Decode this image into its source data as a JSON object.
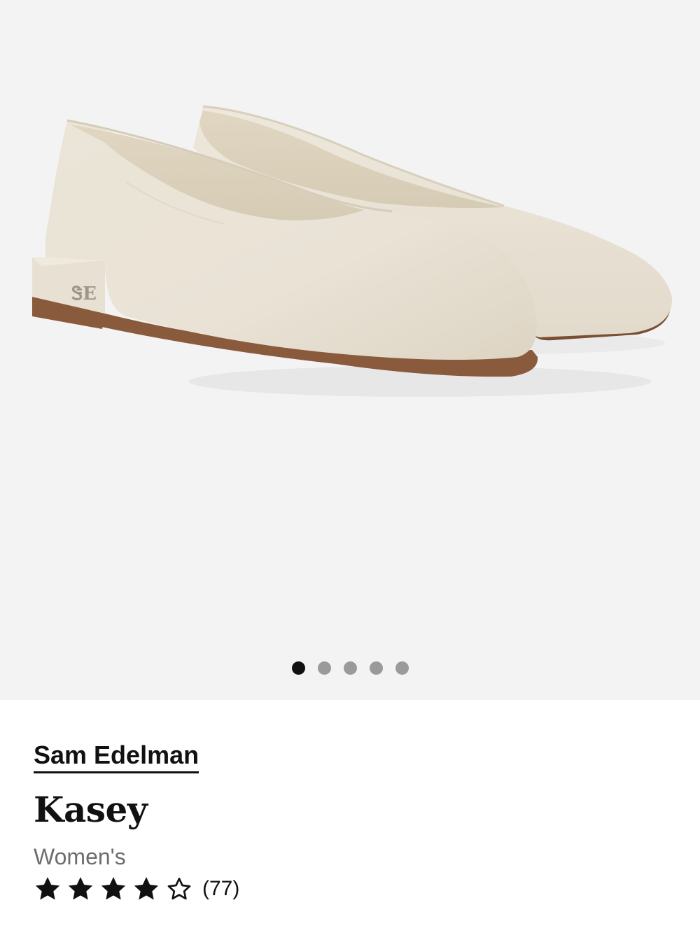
{
  "gallery": {
    "image_name": "shoe-pair-image",
    "slide_count": 5,
    "active_slide": 1,
    "colors": {
      "background": "#f3f3f3",
      "leather": "#ebe5d9",
      "sole": "#8a5a3c",
      "dot_active": "#111111",
      "dot_inactive": "#9a9a9a"
    }
  },
  "product": {
    "brand": "Sam Edelman",
    "name": "Kasey",
    "gender": "Women's",
    "rating": 4,
    "rating_max": 5,
    "review_count": "(77)"
  }
}
